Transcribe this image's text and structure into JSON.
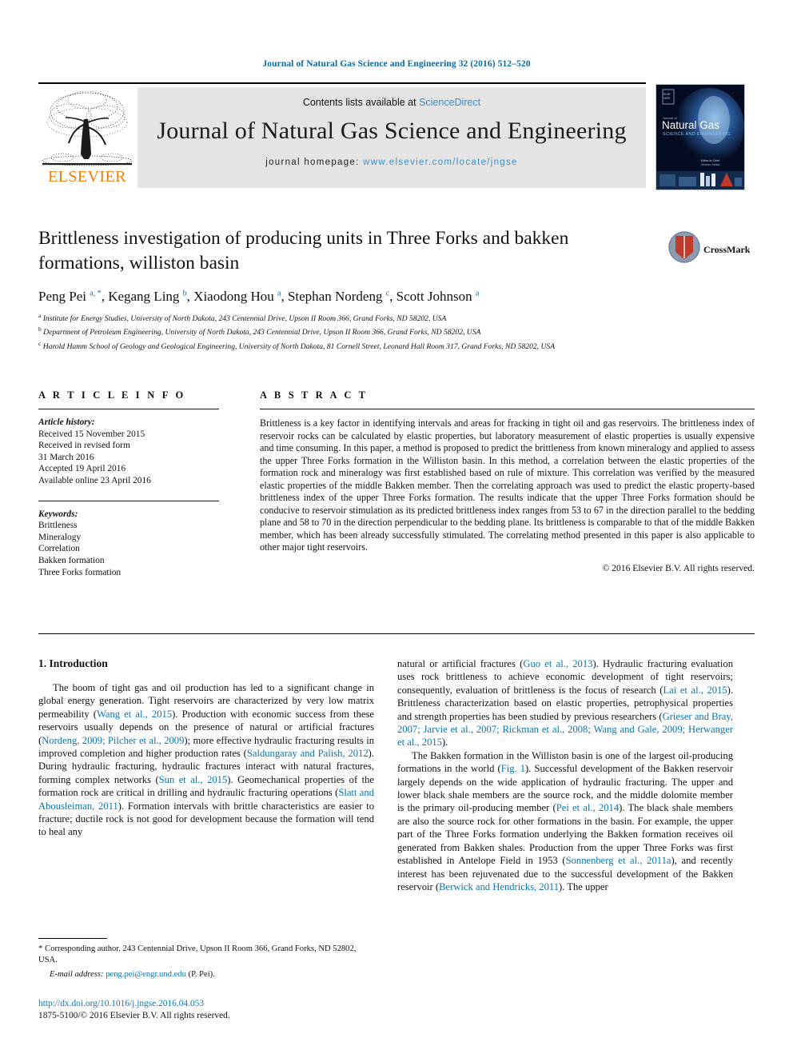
{
  "running_head": "Journal of Natural Gas Science and Engineering 32 (2016) 512–520",
  "masthead": {
    "publisher": "ELSEVIER",
    "contents_prefix": "Contents lists available at ",
    "contents_link": "ScienceDirect",
    "journal_name": "Journal of Natural Gas Science and Engineering",
    "homepage_prefix": "journal homepage: ",
    "homepage_url": "www.elsevier.com/locate/jngse",
    "cover_title_line1": "Natural Gas",
    "cover_title_line2": "SCIENCE AND ENGINEERING",
    "accent_link_color": "#3a8fc4",
    "banner_bg": "#e4e4e4",
    "elsevier_orange": "#f07f09"
  },
  "article": {
    "title": "Brittleness investigation of producing units in Three Forks and bakken formations, williston basin",
    "authors_html": "Peng Pei <sup>a, *</sup>, Kegang Ling <sup>b</sup>, Xiaodong Hou <sup>a</sup>, Stephan Nordeng <sup>c</sup>, Scott Johnson <sup>a</sup>",
    "crossmark_label": "CrossMark",
    "affiliations": [
      {
        "marker": "a",
        "text": "Institute for Energy Studies, University of North Dakota, 243 Centennial Drive, Upson II Room 366, Grand Forks, ND 58202, USA"
      },
      {
        "marker": "b",
        "text": "Department of Petroleum Engineering, University of North Dakota, 243 Centennial Drive, Upson II Room 366, Grand Forks, ND 58202, USA"
      },
      {
        "marker": "c",
        "text": "Harold Hamm School of Geology and Geological Engineering, University of North Dakota, 81 Cornell Street, Leonard Hall Room 317, Grand Forks, ND 58202, USA"
      }
    ]
  },
  "article_info": {
    "heading": "A R T I C L E  I N F O",
    "history_label": "Article history:",
    "history": [
      "Received 15 November 2015",
      "Received in revised form",
      "31 March 2016",
      "Accepted 19 April 2016",
      "Available online 23 April 2016"
    ],
    "keywords_label": "Keywords:",
    "keywords": [
      "Brittleness",
      "Mineralogy",
      "Correlation",
      "Bakken formation",
      "Three Forks formation"
    ]
  },
  "abstract": {
    "heading": "A B S T R A C T",
    "text": "Brittleness is a key factor in identifying intervals and areas for fracking in tight oil and gas reservoirs. The brittleness index of reservoir rocks can be calculated by elastic properties, but laboratory measurement of elastic properties is usually expensive and time consuming. In this paper, a method is proposed to predict the brittleness from known mineralogy and applied to assess the upper Three Forks formation in the Williston basin. In this method, a correlation between the elastic properties of the formation rock and mineralogy was first established based on rule of mixture. This correlation was verified by the measured elastic properties of the middle Bakken member. Then the correlating approach was used to predict the elastic property-based brittleness index of the upper Three Forks formation. The results indicate that the upper Three Forks formation should be conducive to reservoir stimulation as its predicted brittleness index ranges from 53 to 67 in the direction parallel to the bedding plane and 58 to 70 in the direction perpendicular to the bedding plane. Its brittleness is comparable to that of the middle Bakken member, which has been already successfully stimulated. The correlating method presented in this paper is also applicable to other major tight reservoirs.",
    "copyright": "© 2016 Elsevier B.V. All rights reserved."
  },
  "body": {
    "section_heading": "1. Introduction",
    "left_paragraph_1_parts": [
      {
        "t": "The boom of tight gas and oil production has led to a significant change in global energy generation. Tight reservoirs are characterized by very low matrix permeability (",
        "c": false
      },
      {
        "t": "Wang et al., 2015",
        "c": true
      },
      {
        "t": "). Production with economic success from these reservoirs usually depends on the presence of natural or artificial fractures (",
        "c": false
      },
      {
        "t": "Nordeng, 2009; Pilcher et al., 2009",
        "c": true
      },
      {
        "t": "); more effective hydraulic fracturing results in improved completion and higher production rates (",
        "c": false
      },
      {
        "t": "Saldungaray and Palish, 2012",
        "c": true
      },
      {
        "t": "). During hydraulic fracturing, hydraulic fractures interact with natural fractures, forming complex networks (",
        "c": false
      },
      {
        "t": "Sun et al., 2015",
        "c": true
      },
      {
        "t": "). Geomechanical properties of the formation rock are critical in drilling and hydraulic fracturing operations (",
        "c": false
      },
      {
        "t": "Slatt and Abousleiman, 2011",
        "c": true
      },
      {
        "t": "). Formation intervals with brittle characteristics are easier to fracture; ductile rock is not good for development because the formation will tend to heal any",
        "c": false
      }
    ],
    "right_paragraph_1_parts": [
      {
        "t": "natural or artificial fractures (",
        "c": false
      },
      {
        "t": "Guo et al., 2013",
        "c": true
      },
      {
        "t": "). Hydraulic fracturing evaluation uses rock brittleness to achieve economic development of tight reservoirs; consequently, evaluation of brittleness is the focus of research (",
        "c": false
      },
      {
        "t": "Lai et al., 2015",
        "c": true
      },
      {
        "t": "). Brittleness characterization based on elastic properties, petrophysical properties and strength properties has been studied by previous researchers (",
        "c": false
      },
      {
        "t": "Grieser and Bray, 2007; Jarvie et al., 2007; Rickman et al., 2008; Wang and Gale, 2009; Herwanger et al., 2015",
        "c": true
      },
      {
        "t": ").",
        "c": false
      }
    ],
    "right_paragraph_2_parts": [
      {
        "t": "The Bakken formation in the Williston basin is one of the largest oil-producing formations in the world (",
        "c": false
      },
      {
        "t": "Fig. 1",
        "c": true
      },
      {
        "t": "). Successful development of the Bakken reservoir largely depends on the wide application of hydraulic fracturing. The upper and lower black shale members are the source rock, and the middle dolomite member is the primary oil-producing member (",
        "c": false
      },
      {
        "t": "Pei et al., 2014",
        "c": true
      },
      {
        "t": "). The black shale members are also the source rock for other formations in the basin. For example, the upper part of the Three Forks formation underlying the Bakken formation receives oil generated from Bakken shales. Production from the upper Three Forks was first established in Antelope Field in 1953 (",
        "c": false
      },
      {
        "t": "Sonnenberg et al., 2011a",
        "c": true
      },
      {
        "t": "), and recently interest has been rejuvenated due to the successful development of the Bakken reservoir (",
        "c": false
      },
      {
        "t": "Berwick and Hendricks, 2011",
        "c": true
      },
      {
        "t": "). The upper",
        "c": false
      }
    ]
  },
  "footer": {
    "corresponding_star": "*",
    "corresponding_text": " Corresponding author. 243 Centennial Drive, Upson II Room 366, Grand Forks, ND 52802, USA.",
    "email_label": "E-mail address: ",
    "email": "peng.pei@engr.und.edu",
    "email_suffix": " (P. Pei).",
    "doi": "http://dx.doi.org/10.1016/j.jngse.2016.04.053",
    "issn_line": "1875-5100/© 2016 Elsevier B.V. All rights reserved."
  }
}
